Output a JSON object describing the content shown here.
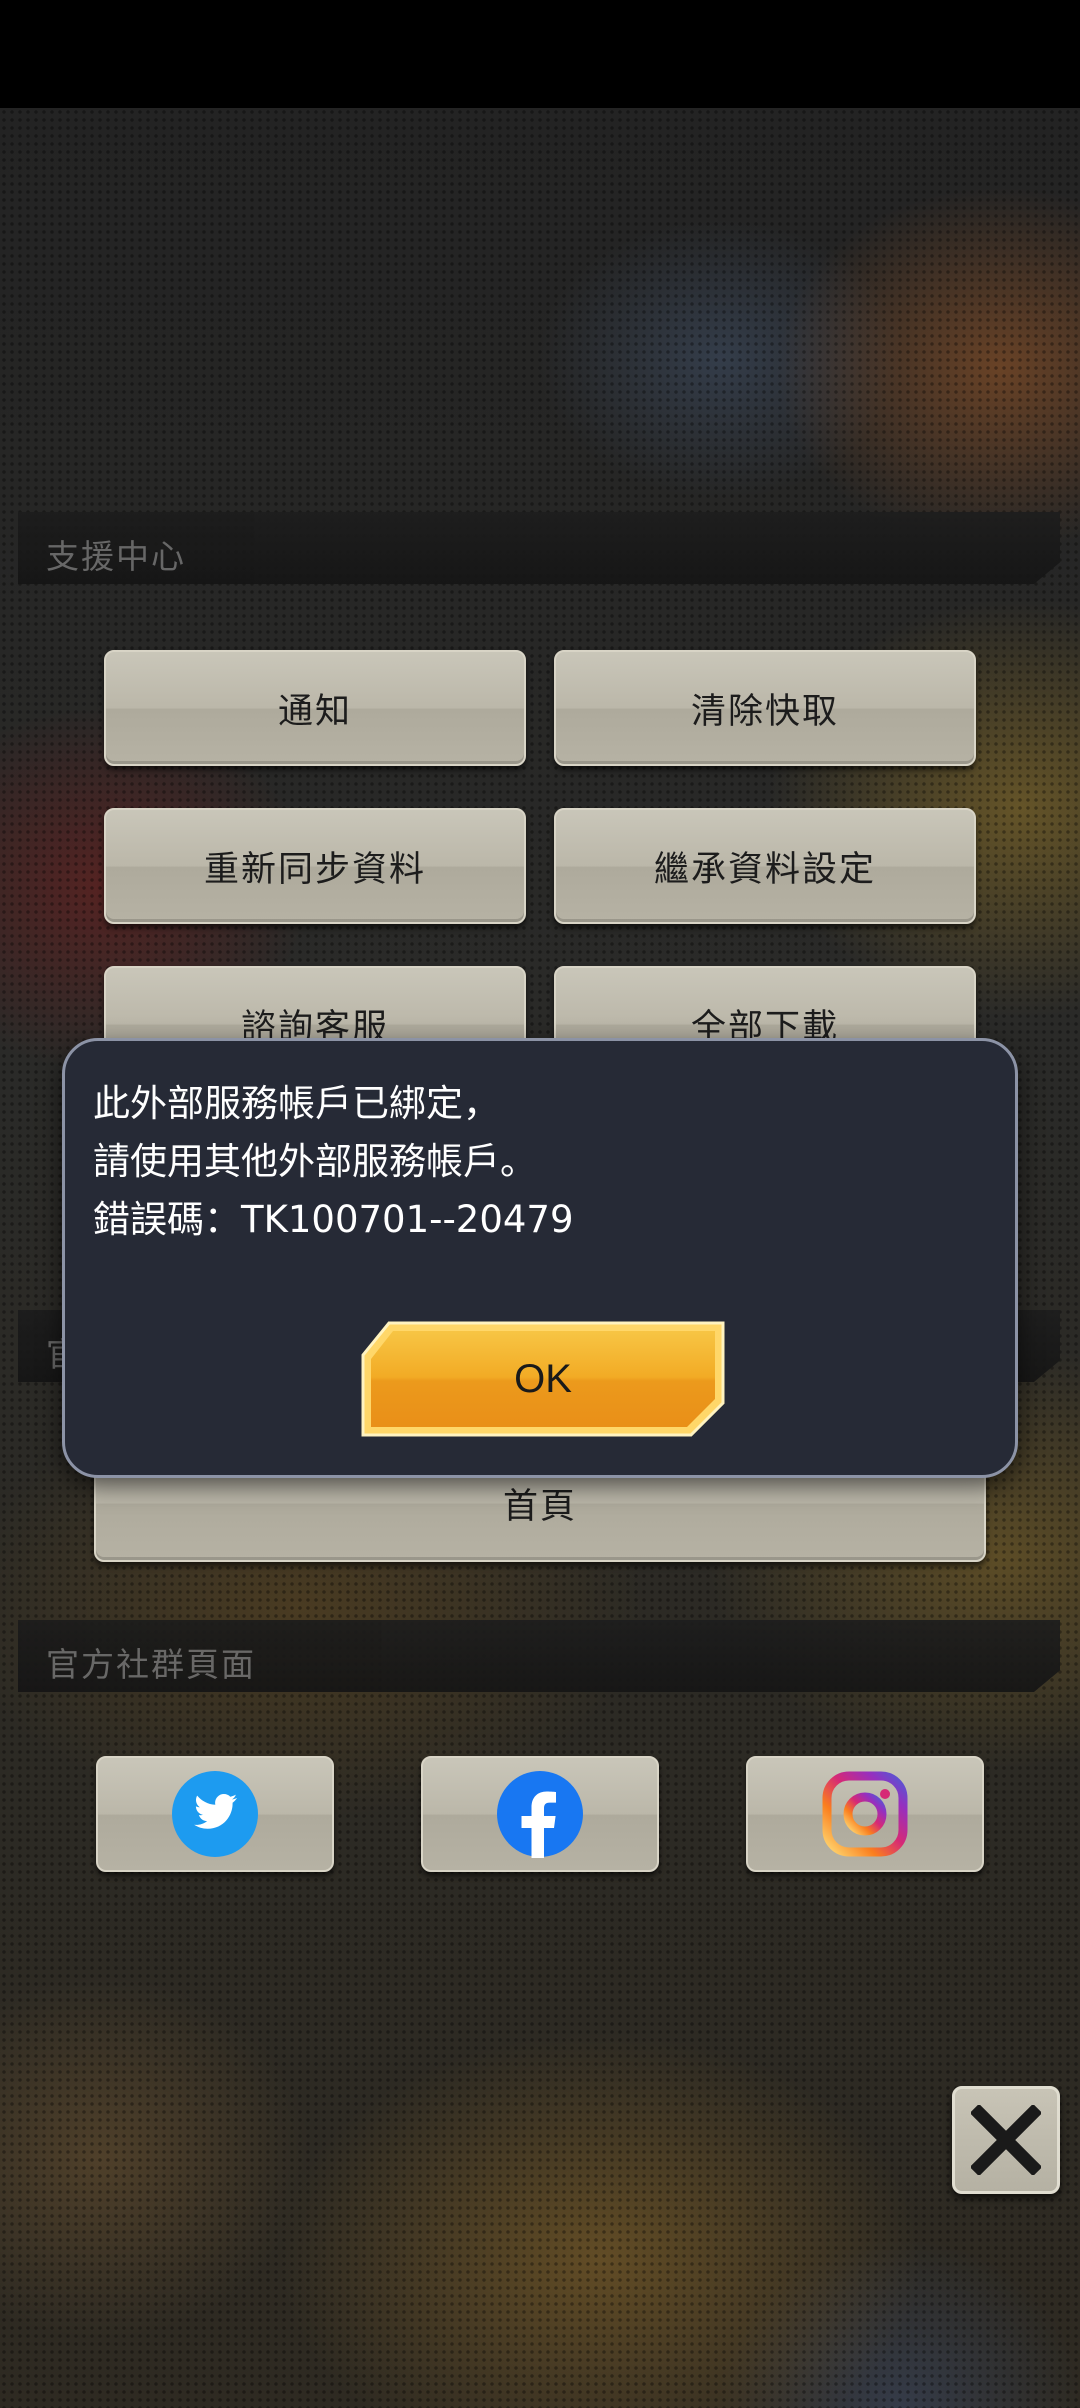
{
  "support_section": {
    "title": "支援中心",
    "buttons": {
      "notice": "通知",
      "clear_cache": "清除快取",
      "resync": "重新同步資料",
      "inherit_settings": "繼承資料設定",
      "contact_support": "諮詢客服",
      "download_all": "全部下載"
    }
  },
  "official_section": {
    "title_partial": "官",
    "home_button": "首頁"
  },
  "community_section": {
    "title": "官方社群頁面",
    "icons": [
      "twitter-icon",
      "facebook-icon",
      "instagram-icon"
    ]
  },
  "dialog": {
    "line1": "此外部服務帳戶已綁定，",
    "line2": "請使用其他外部服務帳戶。",
    "line3": "錯誤碼：TK100701--20479",
    "ok_label": "OK"
  },
  "colors": {
    "dialog_bg": "#262a36",
    "ok_orange": "#f0a52a",
    "twitter_blue": "#1d9bf0",
    "facebook_blue": "#1877f2"
  }
}
